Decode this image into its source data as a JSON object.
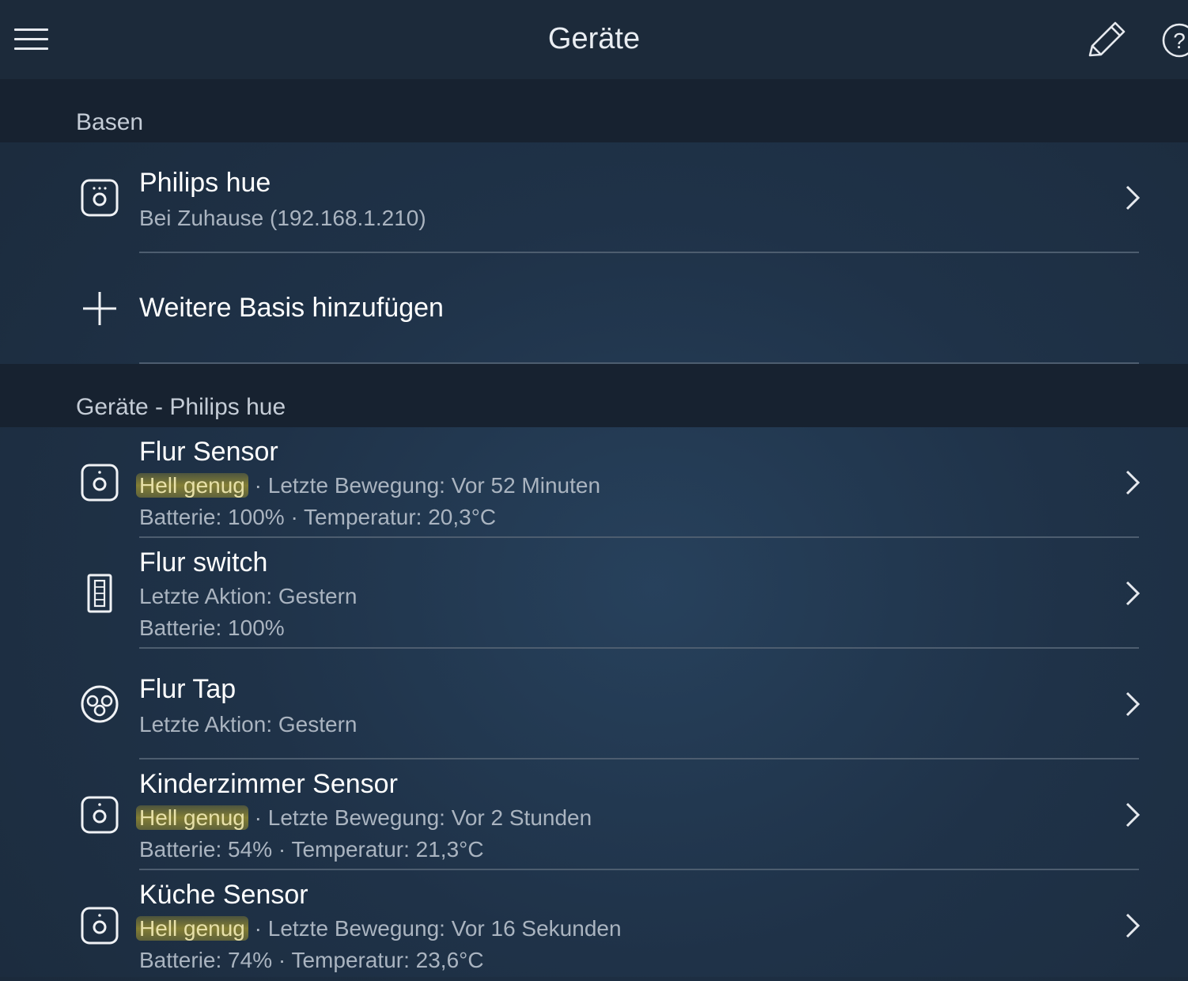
{
  "header": {
    "title": "Geräte",
    "menu_icon": "hamburger-menu-icon",
    "edit_icon": "pencil-icon",
    "help_icon": "question-mark-icon"
  },
  "bases_section": {
    "title": "Basen",
    "items": [
      {
        "name": "Philips hue",
        "subtitle": "Bei Zuhause (192.168.1.210)",
        "icon": "bridge-icon"
      }
    ],
    "add_label": "Weitere Basis hinzufügen"
  },
  "devices_section": {
    "title": "Geräte - Philips hue",
    "items": [
      {
        "name": "Flur Sensor",
        "highlight": "Hell genug",
        "line1": " · Letzte Bewegung: Vor 52 Minuten",
        "line2": "Batterie: 100% · Temperatur: 20,3°C",
        "icon": "motion-sensor-icon"
      },
      {
        "name": "Flur switch",
        "line1": "Letzte Aktion: Gestern",
        "line2": "Batterie: 100%",
        "icon": "dimmer-switch-icon"
      },
      {
        "name": "Flur Tap",
        "line1": "Letzte Aktion: Gestern",
        "icon": "tap-switch-icon"
      },
      {
        "name": "Kinderzimmer Sensor",
        "highlight": "Hell genug",
        "line1": " · Letzte Bewegung: Vor 2 Stunden",
        "line2": "Batterie: 54% · Temperatur: 21,3°C",
        "icon": "motion-sensor-icon"
      },
      {
        "name": "Küche Sensor",
        "highlight": "Hell genug",
        "line1": " · Letzte Bewegung: Vor 16 Sekunden",
        "line2": "Batterie: 74% · Temperatur: 23,6°C",
        "icon": "motion-sensor-icon"
      }
    ]
  },
  "colors": {
    "topbar": "#1c2a3a",
    "section_header": "#172230",
    "highlight": "#d6be28",
    "subtext": "#aab4c0"
  }
}
